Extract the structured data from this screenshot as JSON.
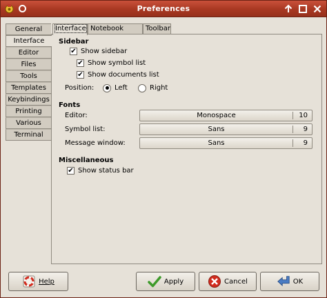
{
  "window": {
    "title": "Preferences"
  },
  "sidebar_tabs": [
    {
      "label": "General"
    },
    {
      "label": "Interface"
    },
    {
      "label": "Editor"
    },
    {
      "label": "Files"
    },
    {
      "label": "Tools"
    },
    {
      "label": "Templates"
    },
    {
      "label": "Keybindings"
    },
    {
      "label": "Printing"
    },
    {
      "label": "Various"
    },
    {
      "label": "Terminal"
    }
  ],
  "top_tabs": [
    {
      "label": "Interface"
    },
    {
      "label": "Notebook tabs"
    },
    {
      "label": "Toolbar"
    }
  ],
  "sidebar_section": {
    "title": "Sidebar",
    "show_sidebar": {
      "label": "Show sidebar",
      "checked": true
    },
    "show_symbol_list": {
      "label": "Show symbol list",
      "checked": true
    },
    "show_documents_list": {
      "label": "Show documents list",
      "checked": true
    },
    "position_label": "Position:",
    "position_left": {
      "label": "Left",
      "selected": true
    },
    "position_right": {
      "label": "Right",
      "selected": false
    }
  },
  "fonts_section": {
    "title": "Fonts",
    "editor": {
      "label": "Editor:",
      "font": "Monospace",
      "size": "10"
    },
    "symbol_list": {
      "label": "Symbol list:",
      "font": "Sans",
      "size": "9"
    },
    "message_window": {
      "label": "Message window:",
      "font": "Sans",
      "size": "9"
    }
  },
  "misc_section": {
    "title": "Miscellaneous",
    "show_status_bar": {
      "label": "Show status bar",
      "checked": true
    }
  },
  "buttons": {
    "help": "Help",
    "apply": "Apply",
    "cancel": "Cancel",
    "ok": "OK"
  },
  "colors": {
    "titlebar": "#a83822",
    "window_bg": "#e6e1d8",
    "apply_icon": "#3d9a2a",
    "cancel_icon": "#d22c1e",
    "ok_icon": "#4a7cc4"
  }
}
